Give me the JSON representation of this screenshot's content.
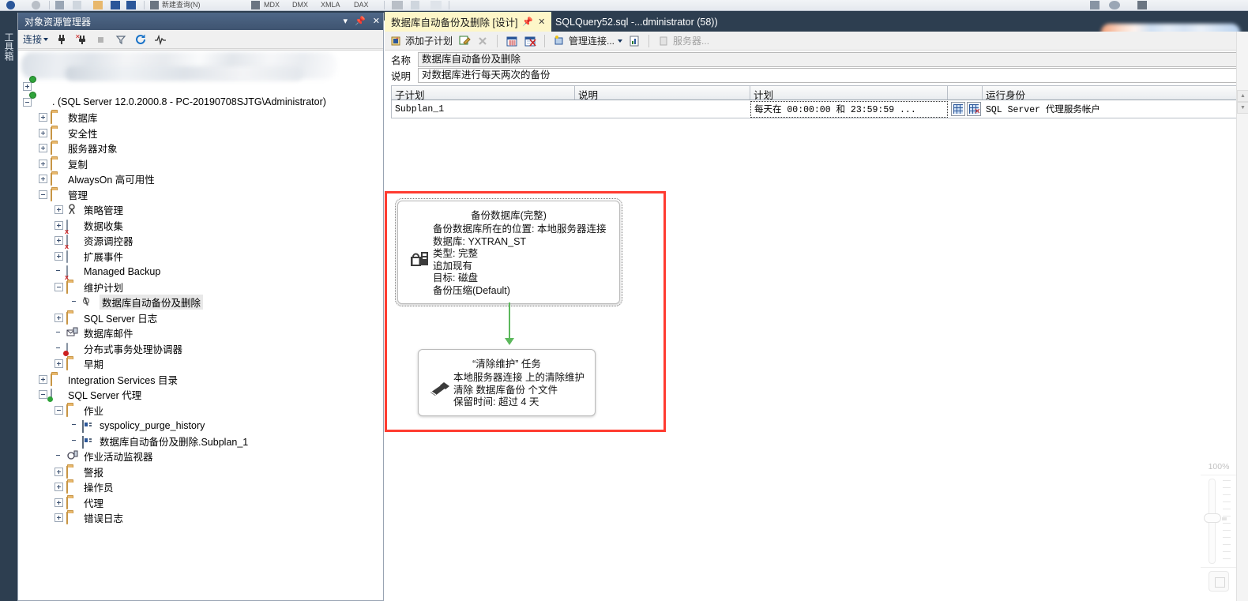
{
  "window": {
    "toolbox_tab": "工具箱"
  },
  "top_toolbar": {
    "items": [
      "新建查询(N)",
      "MDX",
      "DMX",
      "XMLA",
      "DAX"
    ]
  },
  "object_explorer": {
    "title": "对象资源管理器",
    "title_buttons": [
      "chevron-down-icon",
      "pin-icon",
      "close-icon"
    ],
    "toolbar": {
      "connect_label": "连接",
      "icons": [
        "connect-icon",
        "disconnect-icon",
        "stop-icon",
        "filter-icon",
        "refresh-icon",
        "activity-monitor-icon"
      ]
    },
    "tree": [
      {
        "label": "",
        "indent": 0,
        "expander": "plus",
        "icon": "server-icon",
        "redacted": true
      },
      {
        "label": ". (SQL Server 12.0.2000.8 - PC-20190708SJTG\\Administrator)",
        "indent": 0,
        "expander": "minus",
        "icon": "server-icon"
      },
      {
        "label": "数据库",
        "indent": 1,
        "expander": "plus",
        "icon": "folder-icon"
      },
      {
        "label": "安全性",
        "indent": 1,
        "expander": "plus",
        "icon": "folder-icon"
      },
      {
        "label": "服务器对象",
        "indent": 1,
        "expander": "plus",
        "icon": "folder-icon"
      },
      {
        "label": "复制",
        "indent": 1,
        "expander": "plus",
        "icon": "folder-icon"
      },
      {
        "label": "AlwaysOn 高可用性",
        "indent": 1,
        "expander": "plus",
        "icon": "folder-icon"
      },
      {
        "label": "管理",
        "indent": 1,
        "expander": "minus",
        "icon": "folder-icon"
      },
      {
        "label": "策略管理",
        "indent": 2,
        "expander": "plus",
        "icon": "policy-icon"
      },
      {
        "label": "数据收集",
        "indent": 2,
        "expander": "plus",
        "icon": "data-collection-icon"
      },
      {
        "label": "资源调控器",
        "indent": 2,
        "expander": "plus",
        "icon": "resource-governor-icon"
      },
      {
        "label": "扩展事件",
        "indent": 2,
        "expander": "plus",
        "icon": "extended-events-icon"
      },
      {
        "label": "Managed Backup",
        "indent": 2,
        "expander": "none",
        "icon": "managed-backup-icon"
      },
      {
        "label": "维护计划",
        "indent": 2,
        "expander": "minus",
        "icon": "folder-icon"
      },
      {
        "label": "数据库自动备份及删除",
        "indent": 3,
        "expander": "none",
        "icon": "maintenance-plan-icon",
        "selected": true
      },
      {
        "label": "SQL Server 日志",
        "indent": 2,
        "expander": "plus",
        "icon": "folder-icon"
      },
      {
        "label": "数据库邮件",
        "indent": 2,
        "expander": "none",
        "icon": "database-mail-icon"
      },
      {
        "label": "分布式事务处理协调器",
        "indent": 2,
        "expander": "none",
        "icon": "dtc-icon"
      },
      {
        "label": "早期",
        "indent": 2,
        "expander": "plus",
        "icon": "folder-icon"
      },
      {
        "label": "Integration Services 目录",
        "indent": 1,
        "expander": "plus",
        "icon": "folder-icon"
      },
      {
        "label": "SQL Server 代理",
        "indent": 1,
        "expander": "minus",
        "icon": "agent-icon"
      },
      {
        "label": "作业",
        "indent": 2,
        "expander": "minus",
        "icon": "folder-icon"
      },
      {
        "label": "syspolicy_purge_history",
        "indent": 3,
        "expander": "none",
        "icon": "job-icon"
      },
      {
        "label": "数据库自动备份及删除.Subplan_1",
        "indent": 3,
        "expander": "none",
        "icon": "job-icon"
      },
      {
        "label": "作业活动监视器",
        "indent": 2,
        "expander": "none",
        "icon": "job-activity-monitor-icon"
      },
      {
        "label": "警报",
        "indent": 2,
        "expander": "plus",
        "icon": "folder-icon"
      },
      {
        "label": "操作员",
        "indent": 2,
        "expander": "plus",
        "icon": "folder-icon"
      },
      {
        "label": "代理",
        "indent": 2,
        "expander": "plus",
        "icon": "folder-icon"
      },
      {
        "label": "错误日志",
        "indent": 2,
        "expander": "plus",
        "icon": "folder-icon"
      }
    ]
  },
  "tabs": [
    {
      "label": "数据库自动备份及删除 [设计]",
      "active": true,
      "pin": "pin-icon",
      "close": "close-icon"
    },
    {
      "label": "SQLQuery52.sql -...dministrator (58))",
      "active": false
    }
  ],
  "plan_toolbar": {
    "add_subplan": "添加子计划",
    "edit_icon": "edit-subplan-icon",
    "delete_icon": "delete-subplan-icon",
    "schedule_icon": "schedule-icon",
    "remove_schedule_icon": "remove-schedule-icon",
    "manage_connections": "管理连接...",
    "report_icon": "report-icon",
    "server_label": "服务器..."
  },
  "fields": {
    "name_label": "名称",
    "name_value": "数据库自动备份及删除",
    "desc_label": "说明",
    "desc_value": "对数据库进行每天两次的备份"
  },
  "subplan_grid": {
    "columns": [
      "子计划",
      "说明",
      "计划",
      "",
      "运行身份"
    ],
    "rows": [
      {
        "subplan": "Subplan_1",
        "description": "",
        "schedule": "每天在 00:00:00 和 23:59:59 ...",
        "run_as": "SQL Server 代理服务帐户"
      }
    ]
  },
  "design_canvas": {
    "selection_color": "#ff3b30",
    "connector_color": "#5cb85c",
    "tasks": [
      {
        "id": "backup-database-task",
        "title": "备份数据库(完整)",
        "icon": "backup-database-icon",
        "lines": [
          "备份数据库所在的位置: 本地服务器连接",
          "数据库: YXTRAN_ST",
          "类型: 完整",
          "追加现有",
          "目标: 磁盘",
          "备份压缩(Default)"
        ]
      },
      {
        "id": "maintenance-cleanup-task",
        "title": "“清除维护” 任务",
        "icon": "cleanup-broom-icon",
        "lines": [
          "本地服务器连接 上的清除维护",
          "清除 数据库备份 个文件",
          "保留时间: 超过 4 天"
        ]
      }
    ]
  },
  "zoom_control": {
    "percent": "100%",
    "fit_button": "fit-to-window-icon"
  }
}
